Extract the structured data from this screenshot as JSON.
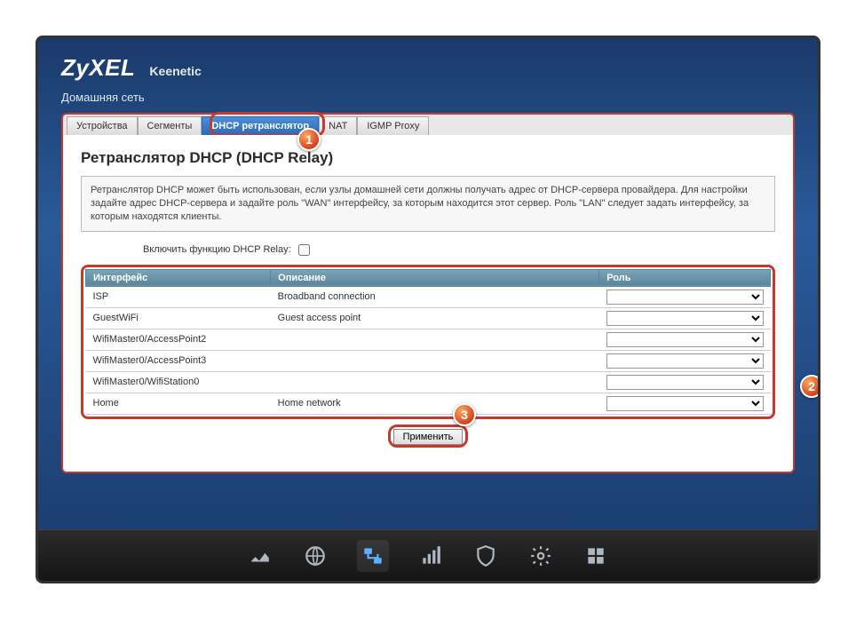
{
  "brand": {
    "logo": "ZyXEL",
    "model": "Keenetic"
  },
  "breadcrumb": "Домашняя сеть",
  "tabs": [
    {
      "label": "Устройства"
    },
    {
      "label": "Сегменты"
    },
    {
      "label": "DHCP ретранслятор"
    },
    {
      "label": "NAT"
    },
    {
      "label": "IGMP Proxy"
    }
  ],
  "page": {
    "title": "Ретранслятор DHCP (DHCP Relay)",
    "description": "Ретранслятор DHCP может быть использован, если узлы домашней сети должны получать адрес от DHCP-сервера провайдера. Для настройки задайте адрес DHCP-сервера и задайте роль \"WAN\" интерфейсу, за которым находится этот сервер. Роль \"LAN\" следует задать интерфейсу, за которым находятся клиенты.",
    "enable_label": "Включить функцию DHCP Relay:",
    "enable_checked": false,
    "table": {
      "headers": {
        "iface": "Интерфейс",
        "desc": "Описание",
        "role": "Роль"
      },
      "rows": [
        {
          "iface": "ISP",
          "desc": "Broadband connection",
          "role": ""
        },
        {
          "iface": "GuestWiFi",
          "desc": "Guest access point",
          "role": ""
        },
        {
          "iface": "WifiMaster0/AccessPoint2",
          "desc": "",
          "role": ""
        },
        {
          "iface": "WifiMaster0/AccessPoint3",
          "desc": "",
          "role": ""
        },
        {
          "iface": "WifiMaster0/WifiStation0",
          "desc": "",
          "role": ""
        },
        {
          "iface": "Home",
          "desc": "Home network",
          "role": ""
        }
      ]
    },
    "apply_label": "Применить"
  },
  "callouts": {
    "c1": "1",
    "c2": "2",
    "c3": "3"
  },
  "dock_icons": [
    "dashboard",
    "globe",
    "network",
    "wifi",
    "shield",
    "settings",
    "apps"
  ]
}
